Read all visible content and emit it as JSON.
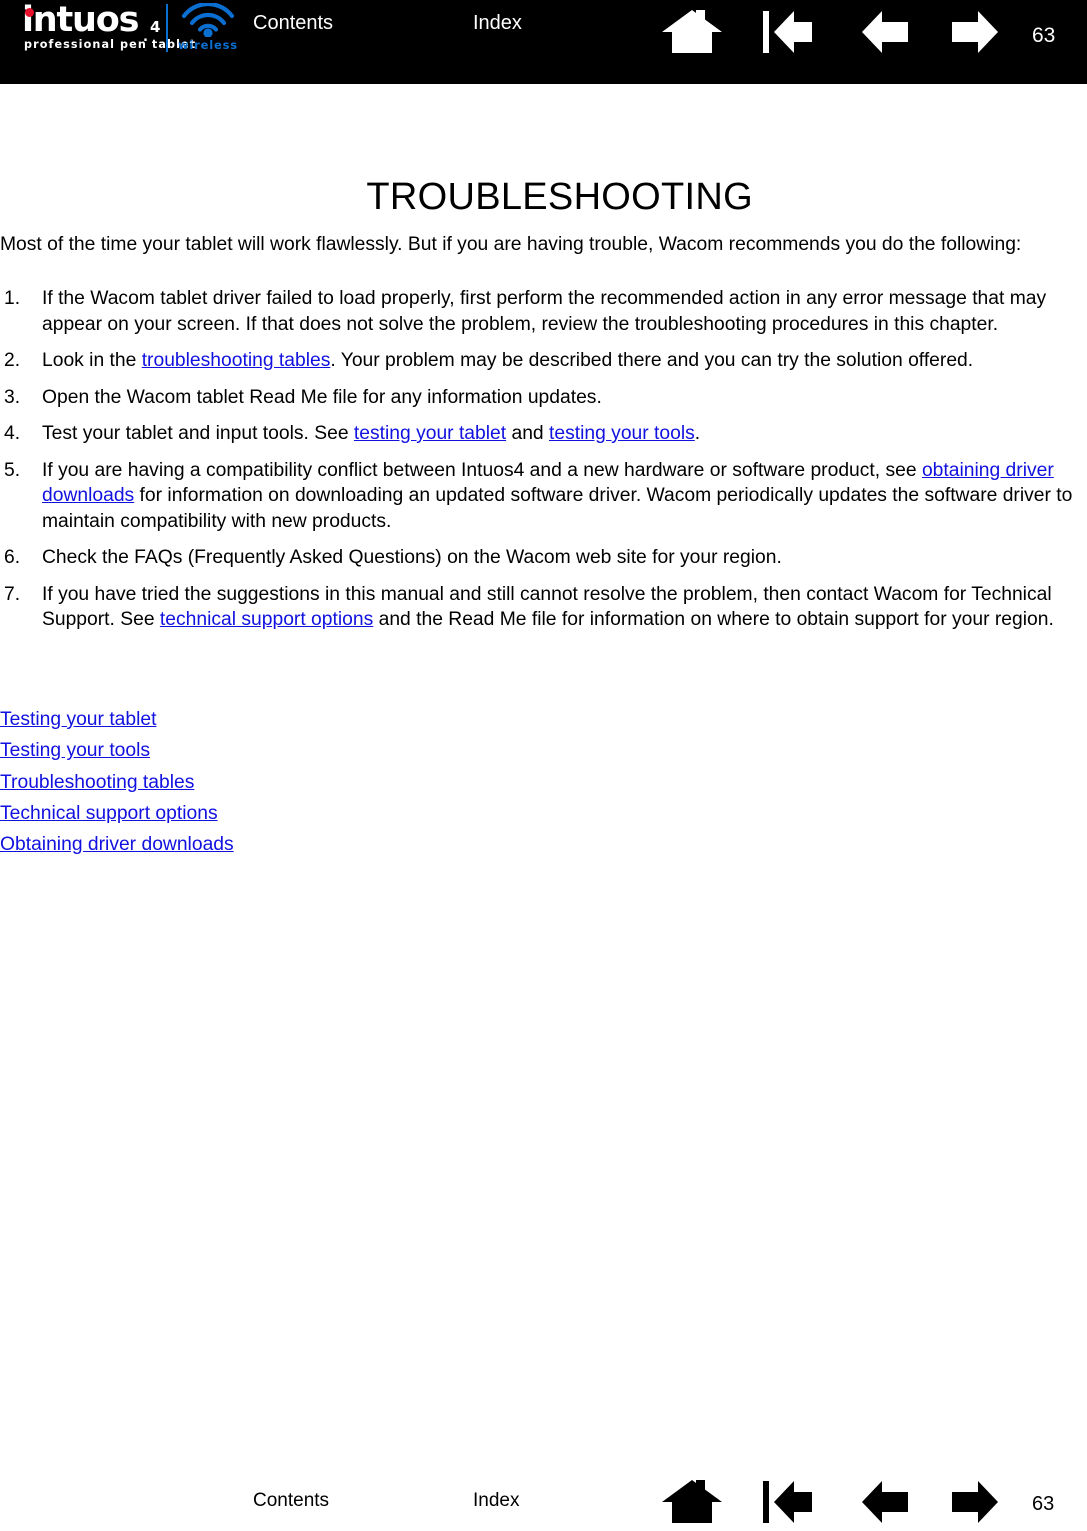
{
  "brand": {
    "wordmark": "intuos",
    "model_suffix": "4",
    "suffix_separator": ".",
    "tagline": "professional pen tablet",
    "wireless_label": "wireless",
    "dot_color": "#e8112d",
    "wireless_color": "#0b6fd1"
  },
  "header": {
    "contents_label": "Contents",
    "index_label": "Index",
    "page_number": "63",
    "background": "#000000",
    "foreground": "#ffffff",
    "icons": [
      {
        "name": "home-icon",
        "label": "Home"
      },
      {
        "name": "first-page-icon",
        "label": "Go to first page"
      },
      {
        "name": "previous-page-icon",
        "label": "Previous page"
      },
      {
        "name": "next-page-icon",
        "label": "Next page"
      }
    ]
  },
  "footer": {
    "contents_label": "Contents",
    "index_label": "Index",
    "page_number": "63",
    "foreground": "#000000"
  },
  "main": {
    "title": "TROUBLESHOOTING",
    "intro": "Most of the time your tablet will work flawlessly.  But if you are having trouble, Wacom recommends you do the following:",
    "link_color": "#1111e0",
    "steps": [
      {
        "number": "1.",
        "parts": [
          {
            "type": "text",
            "value": "If the Wacom tablet driver failed to load properly, first perform the recommended action in any error message that may appear on your screen.  If that does not solve the problem, review the troubleshooting procedures in this chapter."
          }
        ]
      },
      {
        "number": "2.",
        "parts": [
          {
            "type": "text",
            "value": "Look in the "
          },
          {
            "type": "link",
            "value": "troubleshooting tables"
          },
          {
            "type": "text",
            "value": ".  Your problem may be described there and you can try the solution offered."
          }
        ]
      },
      {
        "number": "3.",
        "parts": [
          {
            "type": "text",
            "value": "Open the Wacom tablet Read Me file for any information updates."
          }
        ]
      },
      {
        "number": "4.",
        "parts": [
          {
            "type": "text",
            "value": "Test your tablet and input tools.  See "
          },
          {
            "type": "link",
            "value": "testing your tablet"
          },
          {
            "type": "text",
            "value": " and "
          },
          {
            "type": "link",
            "value": "testing your tools"
          },
          {
            "type": "text",
            "value": "."
          }
        ]
      },
      {
        "number": "5.",
        "parts": [
          {
            "type": "text",
            "value": "If you are having a compatibility conflict between Intuos4 and a new hardware or software product, see "
          },
          {
            "type": "link",
            "value": "obtaining driver downloads"
          },
          {
            "type": "text",
            "value": " for information on downloading an updated software driver.  Wacom periodically updates the software driver to maintain compatibility with new products."
          }
        ]
      },
      {
        "number": "6.",
        "parts": [
          {
            "type": "text",
            "value": "Check the FAQs (Frequently Asked Questions) on the Wacom web site for your region."
          }
        ]
      },
      {
        "number": "7.",
        "parts": [
          {
            "type": "text",
            "value": "If you have tried the suggestions in this manual and still cannot resolve the problem, then contact Wacom for Technical Support.  See "
          },
          {
            "type": "link",
            "value": "technical support options"
          },
          {
            "type": "text",
            "value": " and the Read Me file for information on where to obtain support for your region."
          }
        ]
      }
    ],
    "section_links": [
      "Testing your tablet",
      "Testing your tools",
      "Troubleshooting tables",
      "Technical support options",
      "Obtaining driver downloads"
    ]
  }
}
